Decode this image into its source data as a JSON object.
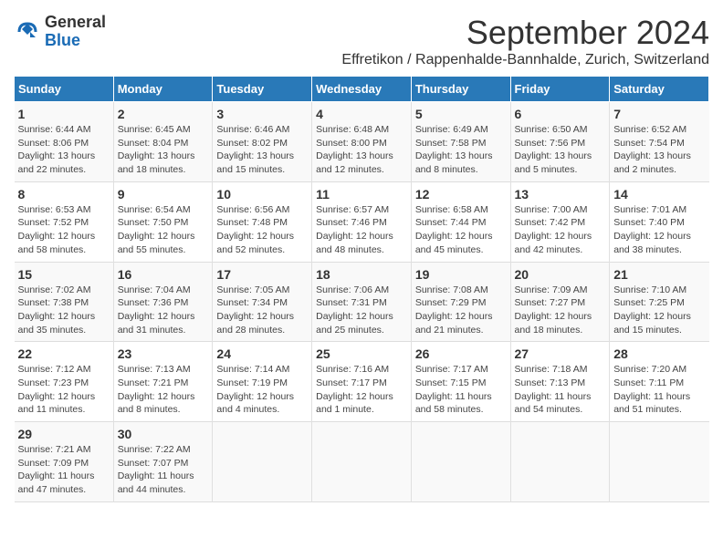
{
  "header": {
    "logo_general": "General",
    "logo_blue": "Blue",
    "title": "September 2024",
    "subtitle": "Effretikon / Rappenhalde-Bannhalde, Zurich, Switzerland"
  },
  "days_of_week": [
    "Sunday",
    "Monday",
    "Tuesday",
    "Wednesday",
    "Thursday",
    "Friday",
    "Saturday"
  ],
  "weeks": [
    [
      {
        "day": "1",
        "sunrise": "Sunrise: 6:44 AM",
        "sunset": "Sunset: 8:06 PM",
        "daylight": "Daylight: 13 hours and 22 minutes."
      },
      {
        "day": "2",
        "sunrise": "Sunrise: 6:45 AM",
        "sunset": "Sunset: 8:04 PM",
        "daylight": "Daylight: 13 hours and 18 minutes."
      },
      {
        "day": "3",
        "sunrise": "Sunrise: 6:46 AM",
        "sunset": "Sunset: 8:02 PM",
        "daylight": "Daylight: 13 hours and 15 minutes."
      },
      {
        "day": "4",
        "sunrise": "Sunrise: 6:48 AM",
        "sunset": "Sunset: 8:00 PM",
        "daylight": "Daylight: 13 hours and 12 minutes."
      },
      {
        "day": "5",
        "sunrise": "Sunrise: 6:49 AM",
        "sunset": "Sunset: 7:58 PM",
        "daylight": "Daylight: 13 hours and 8 minutes."
      },
      {
        "day": "6",
        "sunrise": "Sunrise: 6:50 AM",
        "sunset": "Sunset: 7:56 PM",
        "daylight": "Daylight: 13 hours and 5 minutes."
      },
      {
        "day": "7",
        "sunrise": "Sunrise: 6:52 AM",
        "sunset": "Sunset: 7:54 PM",
        "daylight": "Daylight: 13 hours and 2 minutes."
      }
    ],
    [
      {
        "day": "8",
        "sunrise": "Sunrise: 6:53 AM",
        "sunset": "Sunset: 7:52 PM",
        "daylight": "Daylight: 12 hours and 58 minutes."
      },
      {
        "day": "9",
        "sunrise": "Sunrise: 6:54 AM",
        "sunset": "Sunset: 7:50 PM",
        "daylight": "Daylight: 12 hours and 55 minutes."
      },
      {
        "day": "10",
        "sunrise": "Sunrise: 6:56 AM",
        "sunset": "Sunset: 7:48 PM",
        "daylight": "Daylight: 12 hours and 52 minutes."
      },
      {
        "day": "11",
        "sunrise": "Sunrise: 6:57 AM",
        "sunset": "Sunset: 7:46 PM",
        "daylight": "Daylight: 12 hours and 48 minutes."
      },
      {
        "day": "12",
        "sunrise": "Sunrise: 6:58 AM",
        "sunset": "Sunset: 7:44 PM",
        "daylight": "Daylight: 12 hours and 45 minutes."
      },
      {
        "day": "13",
        "sunrise": "Sunrise: 7:00 AM",
        "sunset": "Sunset: 7:42 PM",
        "daylight": "Daylight: 12 hours and 42 minutes."
      },
      {
        "day": "14",
        "sunrise": "Sunrise: 7:01 AM",
        "sunset": "Sunset: 7:40 PM",
        "daylight": "Daylight: 12 hours and 38 minutes."
      }
    ],
    [
      {
        "day": "15",
        "sunrise": "Sunrise: 7:02 AM",
        "sunset": "Sunset: 7:38 PM",
        "daylight": "Daylight: 12 hours and 35 minutes."
      },
      {
        "day": "16",
        "sunrise": "Sunrise: 7:04 AM",
        "sunset": "Sunset: 7:36 PM",
        "daylight": "Daylight: 12 hours and 31 minutes."
      },
      {
        "day": "17",
        "sunrise": "Sunrise: 7:05 AM",
        "sunset": "Sunset: 7:34 PM",
        "daylight": "Daylight: 12 hours and 28 minutes."
      },
      {
        "day": "18",
        "sunrise": "Sunrise: 7:06 AM",
        "sunset": "Sunset: 7:31 PM",
        "daylight": "Daylight: 12 hours and 25 minutes."
      },
      {
        "day": "19",
        "sunrise": "Sunrise: 7:08 AM",
        "sunset": "Sunset: 7:29 PM",
        "daylight": "Daylight: 12 hours and 21 minutes."
      },
      {
        "day": "20",
        "sunrise": "Sunrise: 7:09 AM",
        "sunset": "Sunset: 7:27 PM",
        "daylight": "Daylight: 12 hours and 18 minutes."
      },
      {
        "day": "21",
        "sunrise": "Sunrise: 7:10 AM",
        "sunset": "Sunset: 7:25 PM",
        "daylight": "Daylight: 12 hours and 15 minutes."
      }
    ],
    [
      {
        "day": "22",
        "sunrise": "Sunrise: 7:12 AM",
        "sunset": "Sunset: 7:23 PM",
        "daylight": "Daylight: 12 hours and 11 minutes."
      },
      {
        "day": "23",
        "sunrise": "Sunrise: 7:13 AM",
        "sunset": "Sunset: 7:21 PM",
        "daylight": "Daylight: 12 hours and 8 minutes."
      },
      {
        "day": "24",
        "sunrise": "Sunrise: 7:14 AM",
        "sunset": "Sunset: 7:19 PM",
        "daylight": "Daylight: 12 hours and 4 minutes."
      },
      {
        "day": "25",
        "sunrise": "Sunrise: 7:16 AM",
        "sunset": "Sunset: 7:17 PM",
        "daylight": "Daylight: 12 hours and 1 minute."
      },
      {
        "day": "26",
        "sunrise": "Sunrise: 7:17 AM",
        "sunset": "Sunset: 7:15 PM",
        "daylight": "Daylight: 11 hours and 58 minutes."
      },
      {
        "day": "27",
        "sunrise": "Sunrise: 7:18 AM",
        "sunset": "Sunset: 7:13 PM",
        "daylight": "Daylight: 11 hours and 54 minutes."
      },
      {
        "day": "28",
        "sunrise": "Sunrise: 7:20 AM",
        "sunset": "Sunset: 7:11 PM",
        "daylight": "Daylight: 11 hours and 51 minutes."
      }
    ],
    [
      {
        "day": "29",
        "sunrise": "Sunrise: 7:21 AM",
        "sunset": "Sunset: 7:09 PM",
        "daylight": "Daylight: 11 hours and 47 minutes."
      },
      {
        "day": "30",
        "sunrise": "Sunrise: 7:22 AM",
        "sunset": "Sunset: 7:07 PM",
        "daylight": "Daylight: 11 hours and 44 minutes."
      },
      null,
      null,
      null,
      null,
      null
    ]
  ]
}
